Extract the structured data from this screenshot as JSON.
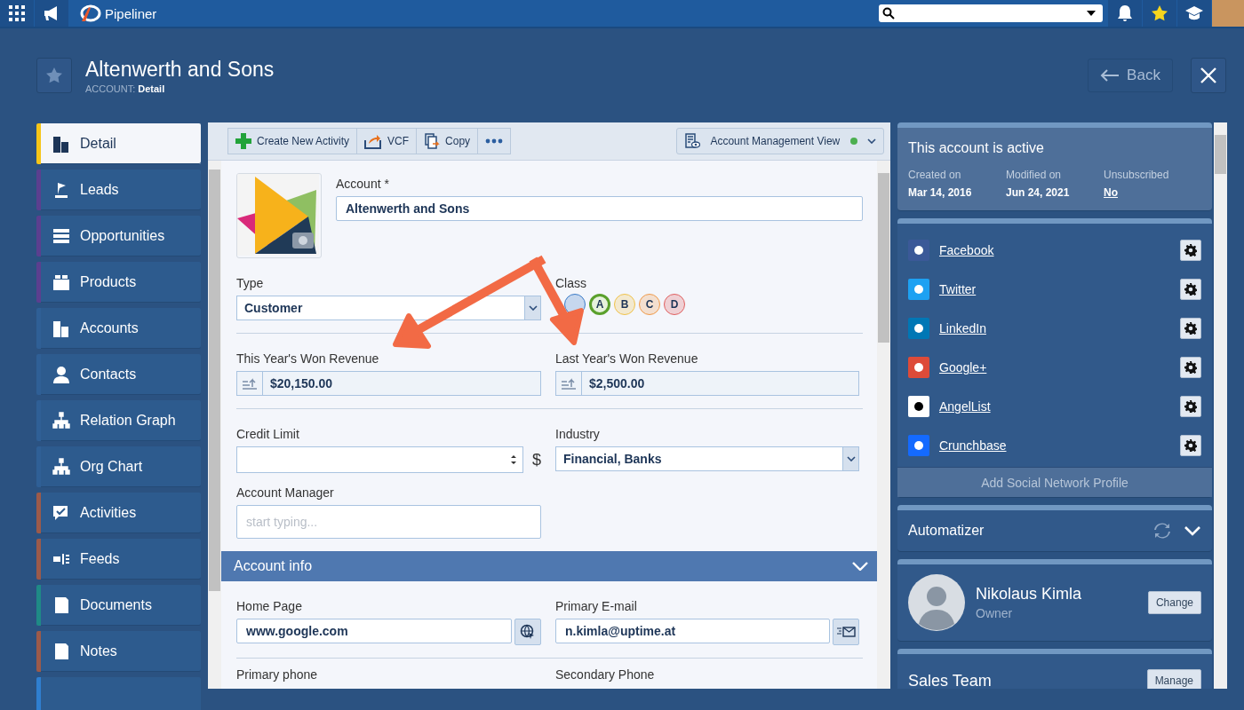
{
  "topbar": {
    "app_name": "Pipeliner"
  },
  "header": {
    "title": "Altenwerth and Sons",
    "breadcrumb_prefix": "ACCOUNT:",
    "breadcrumb_current": "Detail",
    "back": "Back"
  },
  "sidebar": {
    "items": [
      {
        "label": "Detail",
        "selected": true,
        "color": "#f5c518"
      },
      {
        "label": "Leads",
        "selected": false,
        "color": "#5b3f8f"
      },
      {
        "label": "Opportunities",
        "selected": false,
        "color": "#5b3f8f"
      },
      {
        "label": "Products",
        "selected": false,
        "color": "#5b3f8f"
      },
      {
        "label": "Accounts",
        "selected": false,
        "color": "#2f5f96"
      },
      {
        "label": "Contacts",
        "selected": false,
        "color": "#2f5f96"
      },
      {
        "label": "Relation Graph",
        "selected": false,
        "color": "#2f5f96"
      },
      {
        "label": "Org Chart",
        "selected": false,
        "color": "#2f5f96"
      },
      {
        "label": "Activities",
        "selected": false,
        "color": "#9c5a4a"
      },
      {
        "label": "Feeds",
        "selected": false,
        "color": "#9c5a4a"
      },
      {
        "label": "Documents",
        "selected": false,
        "color": "#1f8a86"
      },
      {
        "label": "Notes",
        "selected": false,
        "color": "#9c5a4a"
      },
      {
        "selected": false,
        "color": "#2f7fd0"
      }
    ]
  },
  "toolbar": {
    "buttons": [
      "Create New Activity",
      "VCF",
      "Copy"
    ],
    "view": "Account Management View"
  },
  "form": {
    "account_label": "Account *",
    "account_value": "Altenwerth and Sons",
    "type_label": "Type",
    "type_value": "Customer",
    "class_label": "Class",
    "classes": [
      {
        "selected": false,
        "color": "#3a7bc8"
      },
      {
        "label": "A",
        "selected": true,
        "color": "#5aa02c"
      },
      {
        "label": "B",
        "selected": false,
        "color": "#f0c24a"
      },
      {
        "label": "C",
        "selected": false,
        "color": "#f09a4a"
      },
      {
        "label": "D",
        "selected": false,
        "color": "#e06060"
      }
    ],
    "this_year_label": "This Year's Won Revenue",
    "this_year_value": "$20,150.00",
    "last_year_label": "Last Year's Won Revenue",
    "last_year_value": "$2,500.00",
    "credit_label": "Credit Limit",
    "currency": "$",
    "industry_label": "Industry",
    "industry_value": "Financial, Banks",
    "manager_label": "Account Manager",
    "manager_placeholder": "start typing...",
    "section": "Account info",
    "home_label": "Home Page",
    "home_value": "www.google.com",
    "email_label": "Primary E-mail",
    "email_value": "n.kimla@uptime.at",
    "phone_label": "Primary phone",
    "phone2_label": "Secondary Phone"
  },
  "status": {
    "title": "This account is active",
    "items": [
      {
        "label": "Created on",
        "value": "Mar 14, 2016",
        "link": false
      },
      {
        "label": "Modified on",
        "value": "Jun 24, 2021",
        "link": false
      },
      {
        "label": "Unsubscribed",
        "value": "No",
        "link": true
      }
    ]
  },
  "social": {
    "items": [
      {
        "name": "Facebook",
        "color": "#3b5998"
      },
      {
        "name": "Twitter",
        "color": "#1da1f2"
      },
      {
        "name": "LinkedIn",
        "color": "#0077b5"
      },
      {
        "name": "Google+",
        "color": "#dd4b39"
      },
      {
        "name": "AngelList",
        "color": "#ffffff"
      },
      {
        "name": "Crunchbase",
        "color": "#146aff"
      }
    ],
    "add": "Add Social Network Profile"
  },
  "automatizer": {
    "title": "Automatizer"
  },
  "owner": {
    "name": "Nikolaus Kimla",
    "role": "Owner",
    "button": "Change"
  },
  "sales_team": {
    "title": "Sales Team",
    "button": "Manage"
  }
}
